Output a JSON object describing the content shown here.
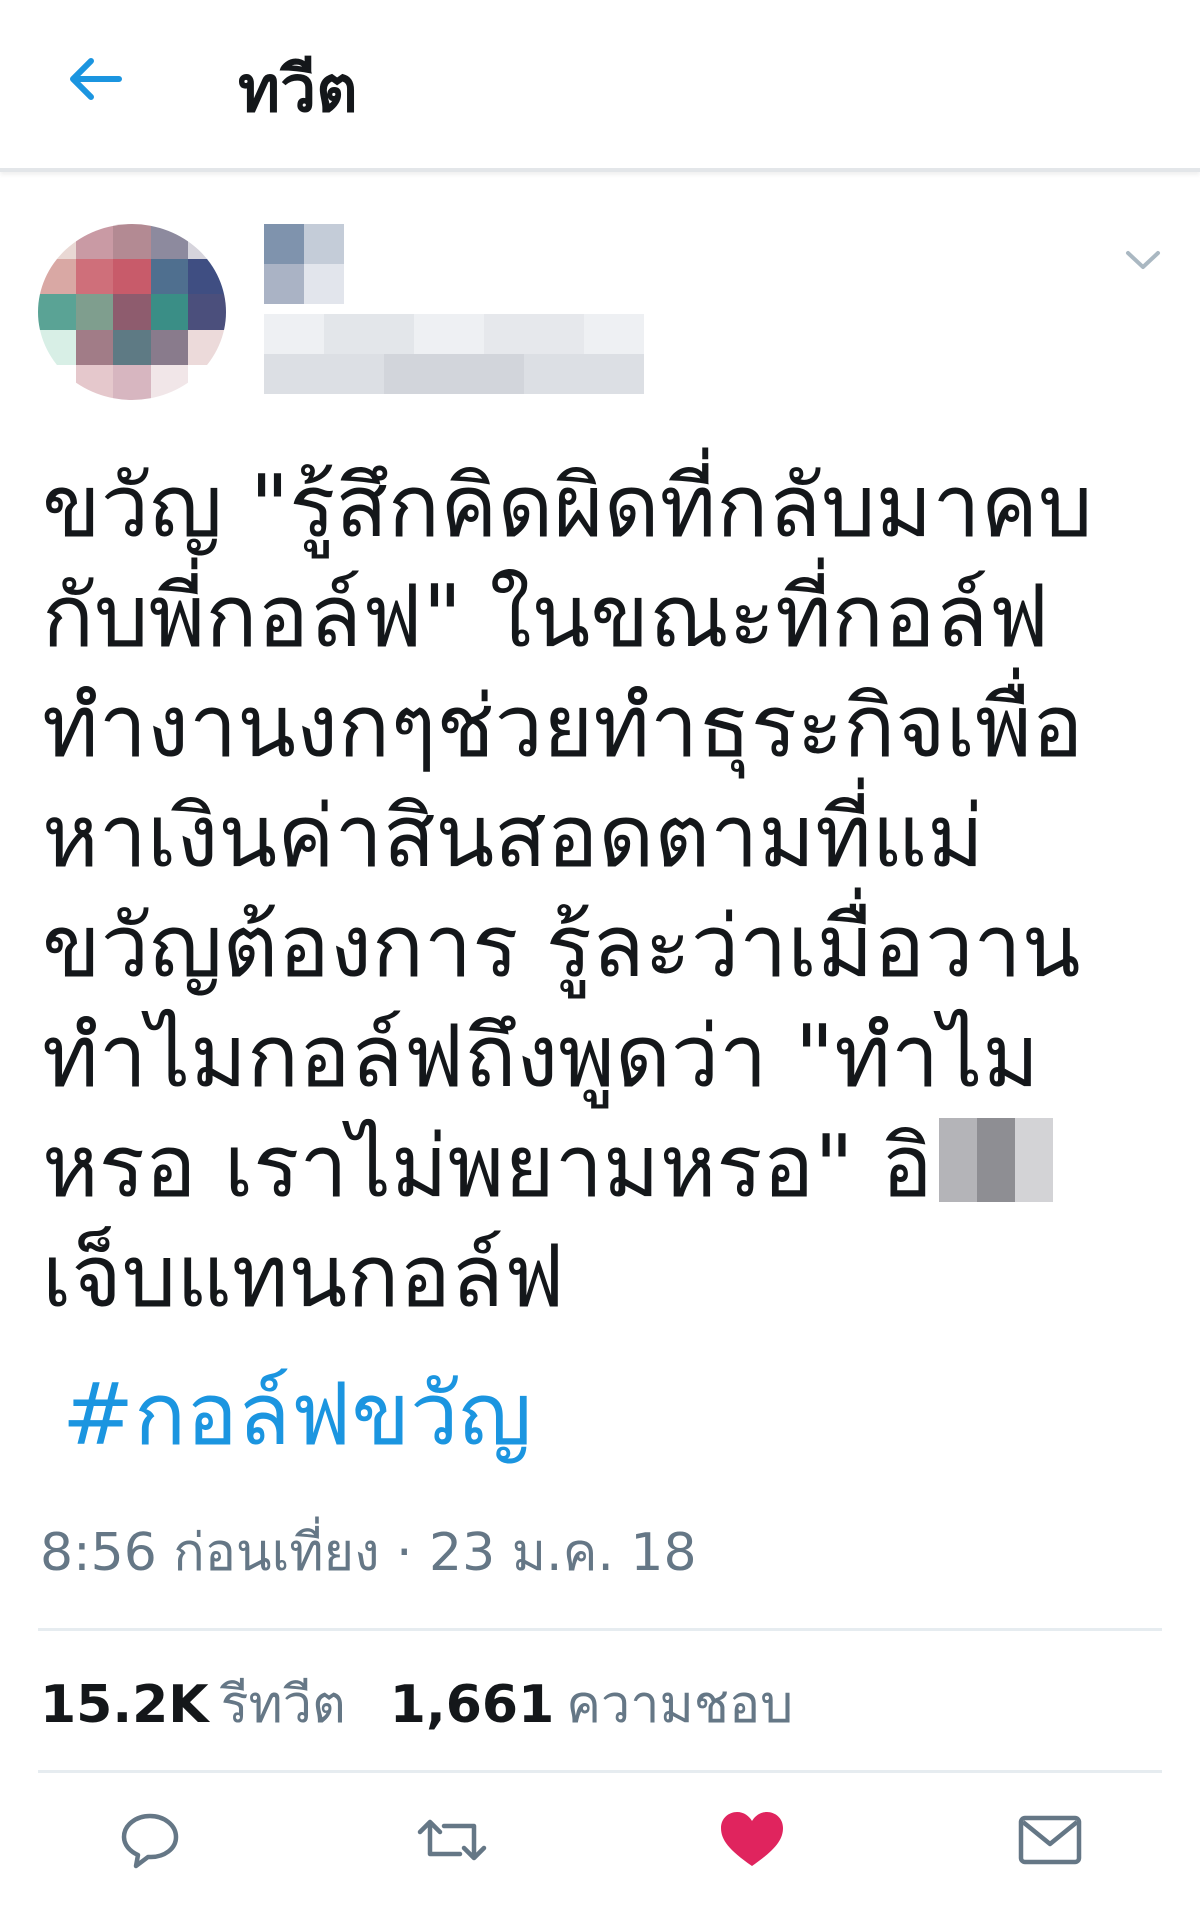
{
  "header": {
    "title": "ทวีต",
    "back_icon": "arrow-left-icon"
  },
  "tweet": {
    "lines": [
      "ขวัญ \"รู้สึกคิดผิดที่กลับมาคบ",
      "กับพี่กอล์ฟ\" ในขณะที่กอล์ฟ",
      "ทำงานงกๆช่วยทำธุระกิจเพื่อ",
      "หาเงินค่าสินสอดตามที่แม่",
      "ขวัญต้องการ รู้ละว่าเมื่อวาน",
      "ทำไมกอล์ฟถึงพูดว่า \"ทำไม",
      "หรอ เราไม่พยามหรอ\" อิ",
      "เจ็บแทนกอล์ฟ"
    ],
    "hashtag": "#กอล์ฟขวัญ",
    "timestamp": "8:56 ก่อนเที่ยง · 23 ม.ค. 18"
  },
  "stats": {
    "retweets_count": "15.2K",
    "retweets_label": "รีทวีต",
    "likes_count": "1,661",
    "likes_label": "ความชอบ"
  },
  "actions": {
    "reply_icon": "reply-icon",
    "retweet_icon": "retweet-icon",
    "like_icon": "heart-icon",
    "dm_icon": "envelope-icon"
  },
  "colors": {
    "accent": "#1b95e0",
    "like": "#e0245e",
    "muted": "#657786",
    "text": "#14171a"
  }
}
